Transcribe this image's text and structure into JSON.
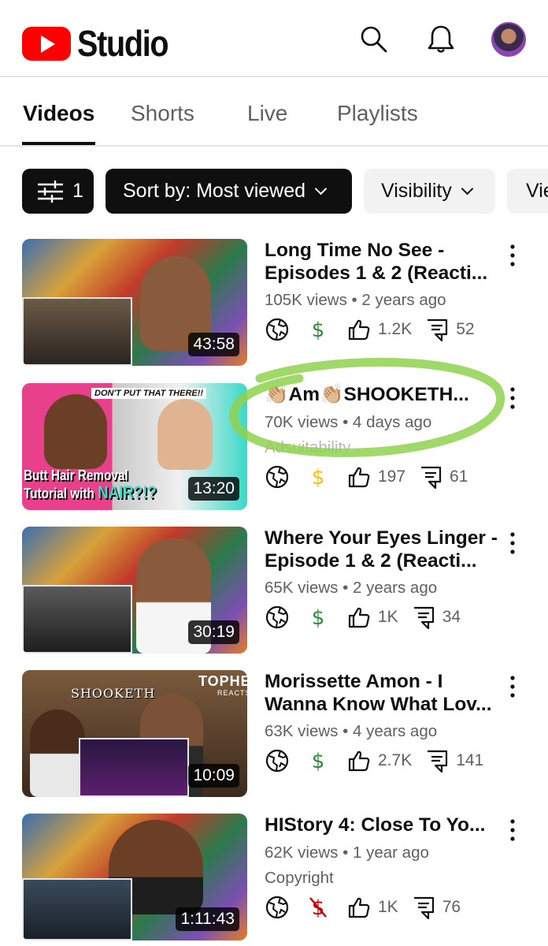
{
  "header": {
    "app_name": "Studio",
    "brand_color": "#ff0000",
    "icons": [
      "search-icon",
      "bell-icon",
      "avatar"
    ]
  },
  "tabs": [
    {
      "label": "Videos",
      "active": true
    },
    {
      "label": "Shorts",
      "active": false
    },
    {
      "label": "Live",
      "active": false
    },
    {
      "label": "Playlists",
      "active": false
    }
  ],
  "filters": {
    "filter_count": "1",
    "sort_label": "Sort by: Most viewed",
    "visibility_label": "Visibility",
    "views_partial_label": "Vie"
  },
  "videos": [
    {
      "title": "Long Time No See - Episodes 1 & 2 (Reacti...",
      "views": "105K views",
      "age": "2 years ago",
      "duration": "43:58",
      "likes": "1.2K",
      "comments": "52",
      "monetization": "on",
      "tag": ""
    },
    {
      "title": "👏🏼Am👏🏼SHOOKETH...",
      "views": "70K views",
      "age": "4 days ago",
      "duration": "13:20",
      "likes": "197",
      "comments": "61",
      "monetization": "pending",
      "tag": "Adsuitability",
      "thumb_text_top": "DON'T PUT THAT THERE!!",
      "thumb_text_1": "Butt Hair Removal",
      "thumb_text_2": "Tutorial with",
      "thumb_text_3": "NAIR?!?"
    },
    {
      "title": "Where Your Eyes Linger - Episode 1 & 2 (Reacti...",
      "views": "65K views",
      "age": "2 years ago",
      "duration": "30:19",
      "likes": "1K",
      "comments": "34",
      "monetization": "on",
      "tag": ""
    },
    {
      "title": "Morissette Amon - I Wanna Know What Lov...",
      "views": "63K views",
      "age": "4 years ago",
      "duration": "10:09",
      "likes": "2.7K",
      "comments": "141",
      "monetization": "on",
      "tag": "",
      "thumb_text_top": "SHOOKETH",
      "thumb_brand_1": "TOPHER",
      "thumb_brand_2": "REACTS"
    },
    {
      "title": "HIStory 4: Close To Yo...",
      "views": "62K views",
      "age": "1 year ago",
      "duration": "1:11:43",
      "likes": "1K",
      "comments": "76",
      "monetization": "off",
      "tag": "Copyright"
    }
  ],
  "colors": {
    "monetization_on": "#2e8b3d",
    "monetization_pending": "#f4c20d",
    "monetization_off": "#cc0000",
    "annotation": "#8fd14f"
  }
}
